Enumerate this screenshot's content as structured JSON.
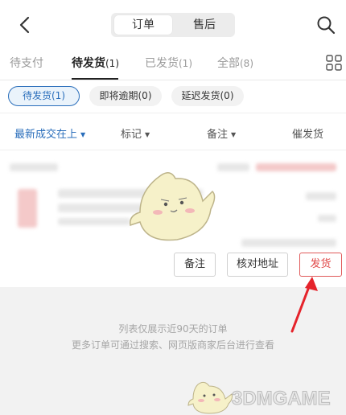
{
  "header": {
    "segments": [
      "订单",
      "售后"
    ],
    "active_segment": "订单"
  },
  "tabs": [
    {
      "label": "待支付",
      "count": ""
    },
    {
      "label": "待发货",
      "count": "(1)"
    },
    {
      "label": "已发货",
      "count": "(1)"
    },
    {
      "label": "全部",
      "count": "(8)"
    }
  ],
  "active_tab": "待发货",
  "chips": [
    {
      "label": "待发货(1)"
    },
    {
      "label": "即将逾期(0)"
    },
    {
      "label": "延迟发货(0)"
    }
  ],
  "sortbar": {
    "sort_label": "最新成交在上",
    "mark_label": "标记",
    "remark_label": "备注",
    "urge_label": "催发货"
  },
  "order_actions": {
    "remark": "备注",
    "verify_address": "核对地址",
    "ship": "发货"
  },
  "footer_note": {
    "line1": "列表仅展示近90天的订单",
    "line2": "更多订单可通过搜索、网页版商家后台进行查看"
  },
  "watermark": {
    "text": "3DMGAME"
  },
  "colors": {
    "accent_blue": "#2a6ebb",
    "ship_red": "#e04848",
    "arrow_red": "#e5232b"
  }
}
